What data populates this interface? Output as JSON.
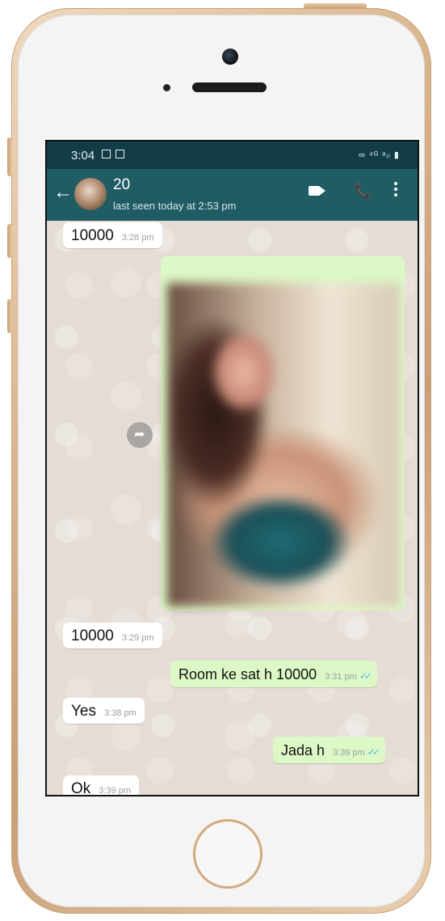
{
  "status_bar": {
    "time": "3:04",
    "right_icons": "∞ ⁴ᴳ ᵃᵢₗ ▮"
  },
  "header": {
    "back_icon": "←",
    "contact_name": "20",
    "last_seen": "last seen today at 2:53 pm",
    "video_icon": "video-call-icon",
    "phone_icon": "📞",
    "menu_icon": "more-options-icon"
  },
  "messages": [
    {
      "direction": "in",
      "text": "10000",
      "time": "3:28 pm"
    },
    {
      "direction": "out",
      "type": "image",
      "share_icon": "➦"
    },
    {
      "direction": "in",
      "text": "10000",
      "time": "3:29 pm"
    },
    {
      "direction": "out",
      "text": "Room ke sat  h 10000",
      "time": "3:31 pm",
      "ticks": "✓✓"
    },
    {
      "direction": "in",
      "text": "Yes",
      "time": "3:38 pm"
    },
    {
      "direction": "out",
      "text": "Jada h",
      "time": "3:39 pm",
      "ticks": "✓✓"
    },
    {
      "direction": "in",
      "text": "Ok",
      "time": "3:39 pm"
    }
  ],
  "colors": {
    "status_bar": "#123d46",
    "header": "#1f5c64",
    "chat_background": "#e5ddd5",
    "outgoing_bubble": "#dcf8c6",
    "incoming_bubble": "#ffffff",
    "read_ticks": "#4fb6ec",
    "phone_frame": "#d9b58e"
  }
}
